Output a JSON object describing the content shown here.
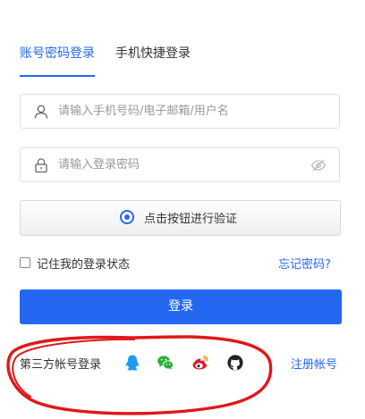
{
  "tabs": {
    "account_password": "账号密码登录",
    "phone_quick": "手机快捷登录"
  },
  "username": {
    "placeholder": "请输入手机号码/电子邮箱/用户名",
    "icon": "user-icon"
  },
  "password": {
    "placeholder": "请输入登录密码",
    "icon": "lock-icon",
    "toggle_icon": "eye-off-icon"
  },
  "verify": {
    "label": "点击按钮进行验证"
  },
  "remember": {
    "label": "记住我的登录状态"
  },
  "forgot_link": "忘记密码?",
  "login_button": "登录",
  "third_party": {
    "label": "第三方帐号登录",
    "providers": [
      "qq-icon",
      "wechat-icon",
      "weibo-icon",
      "github-icon"
    ]
  },
  "register_link": "注册帐号",
  "colors": {
    "primary": "#2468f2",
    "annotation_red": "#e01818",
    "qq": "#1e9bf0",
    "wechat": "#2aae3a",
    "weibo": "#e6162d"
  }
}
